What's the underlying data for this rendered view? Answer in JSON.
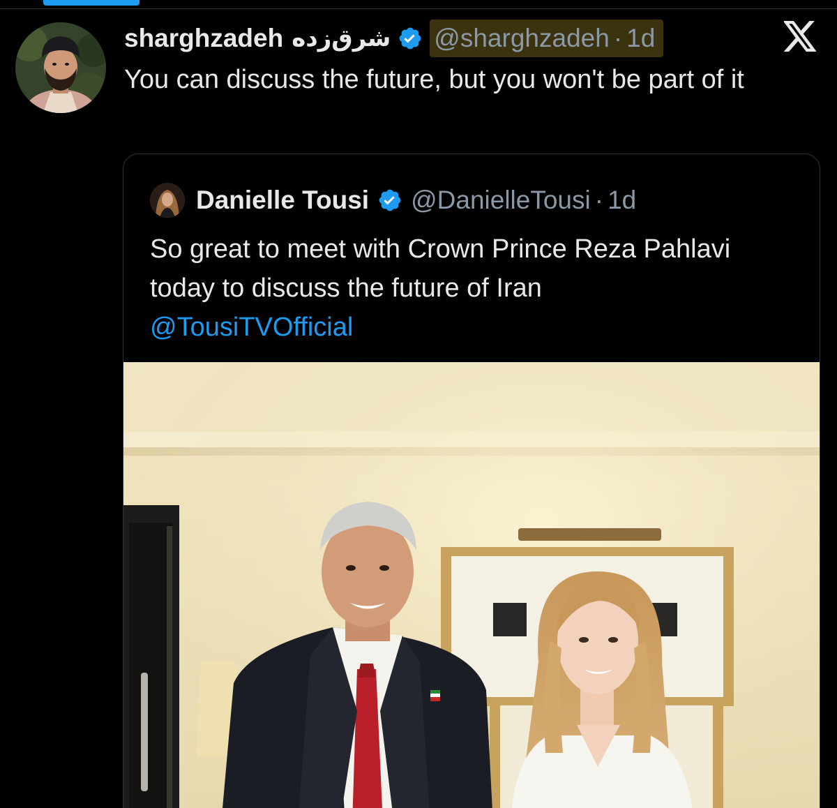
{
  "tweet": {
    "display_name": "sharghzadeh",
    "display_name_persian": "شرق‌زده",
    "handle": "@sharghzadeh",
    "separator": "·",
    "time": "1d",
    "text": "You can discuss the future, but you won't be part of it",
    "verified": true,
    "avatar_icon": "profile-photo-man-beard-headwrap"
  },
  "quoted_tweet": {
    "display_name": "Danielle Tousi",
    "handle": "@DanielleTousi",
    "separator": "·",
    "time": "1d",
    "text": "So great to meet with Crown Prince Reza Pahlavi today to discuss the future of Iran",
    "mention": "@TousiTVOfficial",
    "verified": true,
    "media_description": "photo-two-people-standing-in-room"
  },
  "icons": {
    "platform_logo": "x-logo-icon",
    "verified_badge": "verified-badge-icon"
  },
  "colors": {
    "background": "#000000",
    "text_primary": "#e7e9ea",
    "text_secondary": "#8b98a5",
    "accent": "#1d9bf0",
    "border": "#2f3336",
    "handle_highlight": "#3b3210"
  }
}
